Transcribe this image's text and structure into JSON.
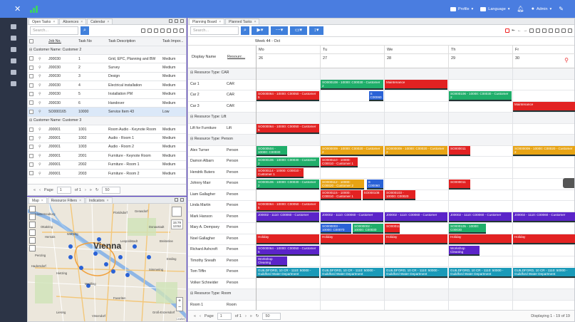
{
  "header": {
    "profile": "Profile",
    "language": "Language",
    "admin": "Admin"
  },
  "left_panel": {
    "tabs": [
      "Open Tasks",
      "Absences",
      "Calendar"
    ],
    "search_placeholder": "Search...",
    "columns": [
      "Job No.",
      "Task No",
      "Task Description",
      "Task Impor..."
    ],
    "groups": [
      {
        "title": "Customer Name: Customer 2",
        "rows": [
          [
            "J00030",
            "1",
            "Grid, EPC, Planning and BW",
            "Medium"
          ],
          [
            "J00030",
            "2",
            "Survey",
            "Medium"
          ],
          [
            "J00030",
            "3",
            "Design",
            "Medium"
          ],
          [
            "J00030",
            "4",
            "Electrical installation",
            "Medium"
          ],
          [
            "J00030",
            "5",
            "Installation PM",
            "Medium"
          ],
          [
            "J00030",
            "6",
            "Handover",
            "Medium"
          ],
          [
            "SO000165",
            "10000",
            "Service Item 43",
            "Low"
          ]
        ]
      },
      {
        "title": "Customer Name: Customer 3",
        "rows": [
          [
            "J00001",
            "1001",
            "Room Audio - Keynote Room",
            "Medium"
          ],
          [
            "J00001",
            "1002",
            "Audio - Room 1",
            "Medium"
          ],
          [
            "J00001",
            "1003",
            "Audio - Room 2",
            "Medium"
          ],
          [
            "J00001",
            "2001",
            "Furniture - Keynote Room",
            "Medium"
          ],
          [
            "J00001",
            "2002",
            "Furniture - Room 1",
            "Medium"
          ],
          [
            "J00001",
            "2003",
            "Furniture - Room 2",
            "Medium"
          ]
        ]
      }
    ],
    "pager": {
      "page_label": "Page",
      "page": "1",
      "of": "of 1",
      "size": "50"
    }
  },
  "map_panel": {
    "tabs": [
      "Map",
      "Resource Filters",
      "Indicators"
    ],
    "city": "Vienna",
    "time_popup": [
      "15:79",
      "13:52"
    ],
    "places": [
      "Floridsdorf",
      "Donaustadt",
      "Leopoldstadt",
      "Ottakring",
      "Hernals",
      "Währing",
      "Meidling",
      "Favoriten",
      "Simmering",
      "Hietzing",
      "Penzing",
      "Liesing",
      "Gerasdorf",
      "Breitenlee",
      "Essling",
      "Groß-Enzersdorf",
      "Klosterneuburg",
      "Vösendorf",
      "Hadersdorf"
    ],
    "attribution": "Leaflet"
  },
  "planning": {
    "tabs": [
      "Planning Board",
      "Planned Tasks"
    ],
    "search_placeholder": "Search...",
    "week": "Week 44 - Oct",
    "col_headers": [
      "Display Name",
      "Resourc..."
    ],
    "days": [
      {
        "d": "Mo",
        "n": "26"
      },
      {
        "d": "Tu",
        "n": "27"
      },
      {
        "d": "We",
        "n": "28"
      },
      {
        "d": "Th",
        "n": "29"
      },
      {
        "d": "Fr",
        "n": "30"
      }
    ],
    "rows": [
      {
        "type": "group",
        "label": "Resource Type: CAR"
      },
      {
        "name": "Car 1",
        "res": "CAR"
      },
      {
        "name": "Car 2",
        "res": "CAR"
      },
      {
        "name": "Car 3",
        "res": "CAR"
      },
      {
        "type": "group",
        "label": "Resource Type: Lift"
      },
      {
        "name": "Lift for Furniture",
        "res": "Lift"
      },
      {
        "type": "group",
        "label": "Resource Type: Person"
      },
      {
        "name": "Alex Turner",
        "res": "Person"
      },
      {
        "name": "Damon Albarn",
        "res": "Person"
      },
      {
        "name": "Hendrik Buters",
        "res": "Person"
      },
      {
        "name": "Johnny Marr",
        "res": "Person"
      },
      {
        "name": "Liam Gallagher",
        "res": "Person"
      },
      {
        "name": "Linda Martin",
        "res": "Person"
      },
      {
        "name": "Mark Hanson",
        "res": "Person"
      },
      {
        "name": "Mary A. Dempsey",
        "res": "Person"
      },
      {
        "name": "Noel Gallagher",
        "res": "Person"
      },
      {
        "name": "Richard Ashcroft",
        "res": "Person"
      },
      {
        "name": "Timothy Sneath",
        "res": "Person"
      },
      {
        "name": "Tom Tiffin",
        "res": "Person"
      },
      {
        "name": "Volker Schneider",
        "res": "Person"
      },
      {
        "type": "group",
        "label": "Resource Type: Room"
      },
      {
        "name": "Room 1",
        "res": "Room"
      }
    ],
    "events": [
      {
        "row": 1,
        "day": 1,
        "span": 1,
        "color": "#1fae6a",
        "text": "SO000108 - 10000: C00030 - Customer 2"
      },
      {
        "row": 1,
        "day": 2,
        "span": 1,
        "color": "#e22222",
        "text": "Maintenance"
      },
      {
        "row": 2,
        "day": 0,
        "span": 1,
        "color": "#e22222",
        "text": "SO000064 - 10000: C00050 - Customer 5"
      },
      {
        "row": 2,
        "day": 1.75,
        "span": 0.25,
        "color": "#2a62d6",
        "text": "S C00060"
      },
      {
        "row": 2,
        "day": 3,
        "span": 1,
        "color": "#1fae6a",
        "text": "SO000106 - 10000: C00030 - Customer 2"
      },
      {
        "row": 3,
        "day": 4,
        "span": 1,
        "color": "#e22222",
        "text": "Maintenance"
      },
      {
        "row": 5,
        "day": 0,
        "span": 1,
        "color": "#e22222",
        "text": "SO000064 - 10000: C00050 - Customer 5"
      },
      {
        "row": 7,
        "day": 0,
        "span": 0.5,
        "color": "#1fae6a",
        "text": "SO000504 - 10000: C00030"
      },
      {
        "row": 7,
        "day": 1,
        "span": 1,
        "color": "#e8a414",
        "text": "SO000009 - 10000: C00020 - Customer 2"
      },
      {
        "row": 7,
        "day": 2,
        "span": 1,
        "color": "#e8a414",
        "text": "SO000009 - 10000: C00020 - Customer 2"
      },
      {
        "row": 7,
        "day": 3,
        "span": 0.35,
        "color": "#e22222",
        "text": "SO000011"
      },
      {
        "row": 7,
        "day": 4,
        "span": 1,
        "color": "#e8a414",
        "text": "SO000009 - 10000: C00020 - Customer 2"
      },
      {
        "row": 8,
        "day": 0,
        "span": 1,
        "color": "#1fae6a",
        "text": "SO000106 - 10000: C00030 - Customer 2"
      },
      {
        "row": 8,
        "day": 1,
        "span": 0.6,
        "color": "#e22222",
        "text": "SO000110 - 10000: C00010 - Customer 1"
      },
      {
        "row": 9,
        "day": 0,
        "span": 0.75,
        "color": "#e22222",
        "text": "SO000114 - 10000: C00010 - Customer 1"
      },
      {
        "row": 10,
        "day": 0,
        "span": 1,
        "color": "#1fae6a",
        "text": "SO000106 - 10000: C00030 - Customer 2"
      },
      {
        "row": 10,
        "day": 1,
        "span": 0.7,
        "color": "#e8a414",
        "text": "SO000112 - 10000: C00020 - Customer 2"
      },
      {
        "row": 10,
        "day": 1.72,
        "span": 0.28,
        "color": "#2a62d6",
        "text": "S C00060"
      },
      {
        "row": 10,
        "day": 3,
        "span": 0.35,
        "color": "#e22222",
        "text": "SO000011"
      },
      {
        "row": 11,
        "day": 1,
        "span": 0.65,
        "color": "#e22222",
        "text": "SO000115 - 10000: C00010 - Customer 1"
      },
      {
        "row": 11,
        "day": 1.65,
        "span": 0.35,
        "color": "#e22222",
        "text": "SO000108"
      },
      {
        "row": 11,
        "day": 2,
        "span": 0.5,
        "color": "#e22222",
        "text": "SO000103 - 10000: C00020"
      },
      {
        "row": 12,
        "day": 0,
        "span": 1,
        "color": "#e22222",
        "text": "SO000064 - 10000: C00050 - Customer 5"
      },
      {
        "row": 13,
        "day": 0,
        "span": 1,
        "color": "#5b24c9",
        "text": "J00002 - 1110: C00060 - Customer"
      },
      {
        "row": 13,
        "day": 1,
        "span": 1,
        "color": "#5b24c9",
        "text": "J00002 - 1110: C00060 - Customer"
      },
      {
        "row": 13,
        "day": 2,
        "span": 1,
        "color": "#5b24c9",
        "text": "J00002 - 1110: C00060 - Customer"
      },
      {
        "row": 13,
        "day": 3,
        "span": 1,
        "color": "#5b24c9",
        "text": "J00002 - 1110: C00060 - Customer"
      },
      {
        "row": 13,
        "day": 4,
        "span": 1,
        "color": "#5b24c9",
        "text": "J00002 - 1110: C00060 - Customer"
      },
      {
        "row": 14,
        "day": 1,
        "span": 0.5,
        "color": "#2a62d6",
        "text": "SO000003 - 10000: C00070"
      },
      {
        "row": 14,
        "day": 1.5,
        "span": 0.5,
        "color": "#1fae6a",
        "text": "SO000002 - 10000: C00030"
      },
      {
        "row": 14,
        "day": 2,
        "span": 0.25,
        "color": "#e22222",
        "text": "SO000111"
      },
      {
        "row": 14,
        "day": 3,
        "span": 0.6,
        "color": "#1fae6a",
        "text": "SO000105 - 10000: C00030"
      },
      {
        "row": 15,
        "day": 0,
        "span": 1,
        "color": "#e22222",
        "text": "Holiday"
      },
      {
        "row": 15,
        "day": 1,
        "span": 1,
        "color": "#e22222",
        "text": "Holiday"
      },
      {
        "row": 15,
        "day": 2,
        "span": 1,
        "color": "#e22222",
        "text": "Holiday"
      },
      {
        "row": 15,
        "day": 3,
        "span": 1,
        "color": "#e22222",
        "text": "Holiday"
      },
      {
        "row": 15,
        "day": 4,
        "span": 1,
        "color": "#e22222",
        "text": "Holiday"
      },
      {
        "row": 16,
        "day": 0,
        "span": 1,
        "color": "#5b24c9",
        "text": "SO000064 - 10000: C00050 - Customer 5"
      },
      {
        "row": 16,
        "day": 3,
        "span": 0.5,
        "color": "#5b24c9",
        "text": "Workshop Cleaning"
      },
      {
        "row": 17,
        "day": 0,
        "span": 0.5,
        "color": "#5b24c9",
        "text": "Workshop Cleaning"
      },
      {
        "row": 18,
        "day": 0,
        "span": 1,
        "color": "#1a9ab8",
        "text": "GUILDFORD, 10 CR - 1110: 50000 - Guildford Water Department"
      },
      {
        "row": 18,
        "day": 1,
        "span": 1,
        "color": "#1a9ab8",
        "text": "GUILDFORD, 10 CR - 1110: 50000 - Guildford Water Department"
      },
      {
        "row": 18,
        "day": 2,
        "span": 1,
        "color": "#1a9ab8",
        "text": "GUILDFORD, 10 CR - 1110: 50000 - Guildford Water Department"
      },
      {
        "row": 18,
        "day": 3,
        "span": 1,
        "color": "#1a9ab8",
        "text": "GUILDFORD, 10 CR - 1110: 50000 - Guildford Water Department"
      },
      {
        "row": 18,
        "day": 4,
        "span": 1,
        "color": "#1a9ab8",
        "text": "GUILDFORD, 10 CR - 1110: 50000 - Guildford Water Department"
      }
    ],
    "pager": {
      "page_label": "Page",
      "page": "1",
      "of": "of 1",
      "size": "50",
      "displaying": "Displaying 1 - 19 of 19"
    }
  }
}
